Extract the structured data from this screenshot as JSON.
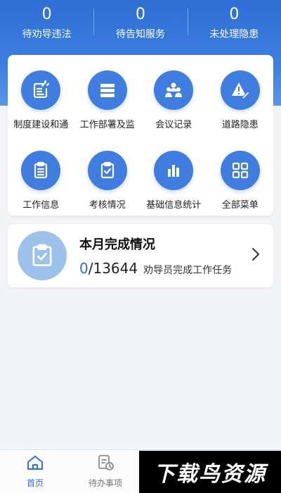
{
  "colors": {
    "primary": "#3f7de0",
    "header": "#2f6fd6",
    "accent_light": "#9cc2ec"
  },
  "stats": [
    {
      "value": "0",
      "label": "待劝导违法"
    },
    {
      "value": "0",
      "label": "待告知服务"
    },
    {
      "value": "0",
      "label": "未处理隐患"
    }
  ],
  "menu": [
    {
      "label": "制度建设和通",
      "icon": "edit-doc-icon"
    },
    {
      "label": "工作部署及监",
      "icon": "server-list-icon"
    },
    {
      "label": "会议记录",
      "icon": "meeting-people-icon"
    },
    {
      "label": "道路隐患",
      "icon": "warning-pen-icon"
    },
    {
      "label": "工作信息",
      "icon": "clipboard-icon"
    },
    {
      "label": "考核情况",
      "icon": "clipboard-check-icon"
    },
    {
      "label": "基础信息统计",
      "icon": "bar-chart-icon"
    },
    {
      "label": "全部菜单",
      "icon": "grid-icon"
    }
  ],
  "progress": {
    "title": "本月完成情况",
    "done": "0",
    "total": "/13644",
    "description": "劝导员完成工作任务",
    "icon": "clipboard-check-icon"
  },
  "tabs": [
    {
      "label": "首页",
      "icon": "home-icon",
      "active": true
    },
    {
      "label": "待办事项",
      "icon": "todo-clock-icon",
      "active": false
    }
  ],
  "watermark": "下载鸟资源"
}
